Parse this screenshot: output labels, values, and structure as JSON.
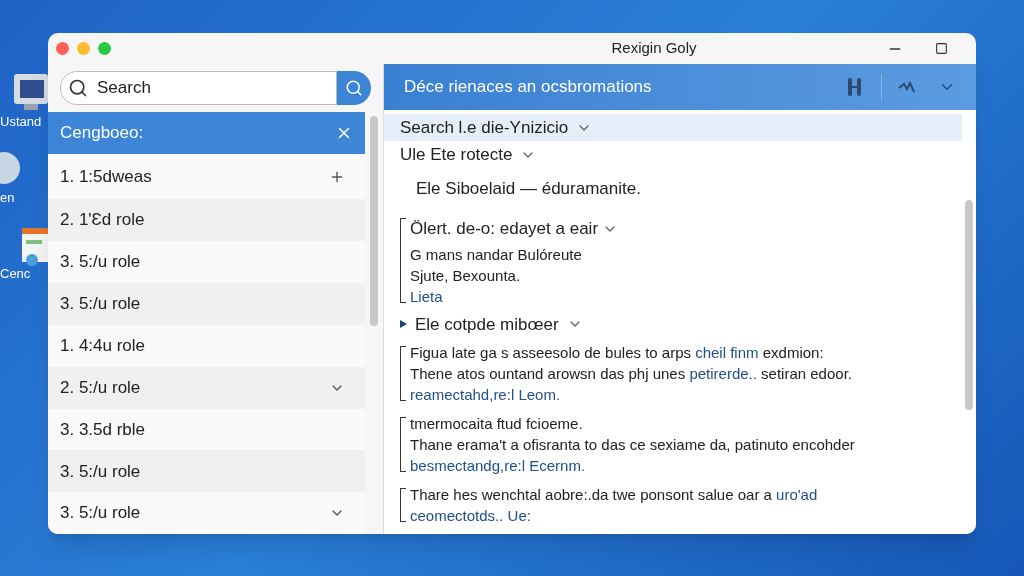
{
  "desktop_icons": [
    {
      "label": "Ustand"
    },
    {
      "label": "en"
    },
    {
      "label": "Cenc"
    }
  ],
  "window": {
    "title": "Rexigin Goly"
  },
  "sidebar": {
    "search": {
      "placeholder": "Search"
    },
    "header": {
      "label": "Cengboeo:"
    },
    "items": [
      {
        "label": "1. 1:5dweas",
        "kind": "plus"
      },
      {
        "label": "2. 1'Ɛd role",
        "kind": "none"
      },
      {
        "label": "3. 5:/u role",
        "kind": "none"
      },
      {
        "label": "3. 5:/u role",
        "kind": "none"
      },
      {
        "label": "1. 4:4u role",
        "kind": "none"
      },
      {
        "label": "2. 5:/u role",
        "kind": "chevron"
      },
      {
        "label": "3. 3.5d rble",
        "kind": "none"
      },
      {
        "label": "3. 5:/u role",
        "kind": "none"
      },
      {
        "label": "3. 5:/u role",
        "kind": "chevron"
      }
    ]
  },
  "content": {
    "title": "Déce rienaces an ocsbromations",
    "items": [
      {
        "kind": "heading",
        "text": "Search l.e die-Ynizicio",
        "selected": true,
        "marker": false
      },
      {
        "kind": "heading",
        "text": "Ule Ete rotecte",
        "selected": false,
        "marker": false
      },
      {
        "kind": "text",
        "text": "Ele Siboelaid — éduramanite."
      },
      {
        "kind": "group",
        "heading": "Ölert. de-o: edayet a eair",
        "lines": [
          [
            {
              "text": "G mans nandar Bulóreute",
              "link": false
            }
          ],
          [
            {
              "text": "Sjute, Bexounta.",
              "link": false
            }
          ],
          [
            {
              "text": "Lieta",
              "link": true
            }
          ]
        ]
      },
      {
        "kind": "heading",
        "text": "Ele cotpde mibœer",
        "selected": false,
        "marker": true
      },
      {
        "kind": "group",
        "lines": [
          [
            {
              "text": "Figua late ga s asseesolo de bules to arps ",
              "link": false
            },
            {
              "text": "cheil finm",
              "link": true
            },
            {
              "text": " exdmion:",
              "link": false
            }
          ],
          [
            {
              "text": "Thene atos ountand arowsn das phj unes ",
              "link": false
            },
            {
              "text": "petirerde..",
              "link": true
            },
            {
              "text": " setiran edoor.",
              "link": false
            }
          ],
          [
            {
              "text": "reamectahd,re:l Leom.",
              "link": true
            }
          ]
        ]
      },
      {
        "kind": "group",
        "lines": [
          [
            {
              "text": "tmermocaita ftud fcioeme.",
              "link": false
            }
          ],
          [
            {
              "text": "Thane erama't a ofisranta to das ce sexiame da, patinuto encohder",
              "link": false
            }
          ],
          [
            {
              "text": "besmectandg,re:l Ecernm.",
              "link": true
            }
          ]
        ]
      },
      {
        "kind": "group",
        "lines": [
          [
            {
              "text": "Thare hes wenchtal aobre:.da twe ponsont salue oar a ",
              "link": false
            },
            {
              "text": "uro'ad",
              "link": true
            }
          ],
          [
            {
              "text": "ceomectotds.. Ue:",
              "link": true
            }
          ]
        ]
      }
    ]
  }
}
